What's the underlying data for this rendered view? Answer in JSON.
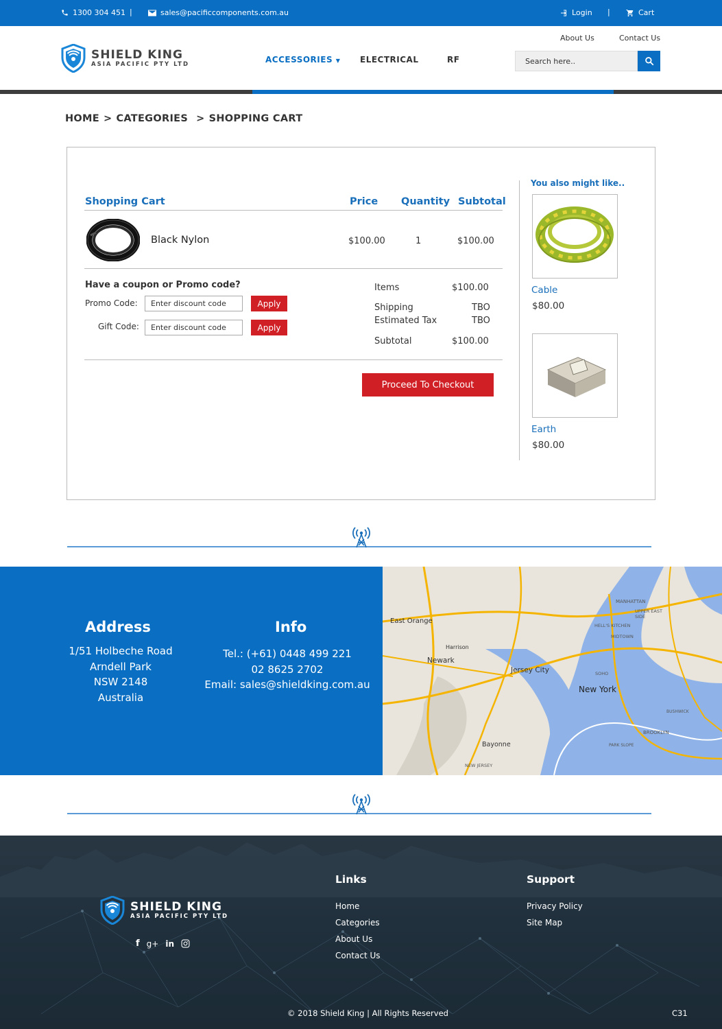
{
  "topbar": {
    "phone": "1300 304 451",
    "divider": "|",
    "email": "sales@pacificcomponents.com.au",
    "login": "Login",
    "cart": "Cart"
  },
  "header": {
    "about": "About Us",
    "contact": "Contact Us",
    "brand_line1": "SHIELD KING",
    "brand_line2": "ASIA PACIFIC PTY LTD",
    "nav": [
      "ACCESSORIES",
      "ELECTRICAL",
      "RF"
    ],
    "search_placeholder": "Search here.."
  },
  "breadcrumb": [
    "HOME",
    ">",
    "CATEGORIES",
    ">",
    "SHOPPING CART"
  ],
  "cart": {
    "title": "Shopping Cart",
    "col_price": "Price",
    "col_quantity": "Quantity",
    "col_subtotal": "Subtotal",
    "item": {
      "name": "Black Nylon",
      "price": "$100.00",
      "qty": "1",
      "subtotal": "$100.00"
    },
    "coupon_title": "Have a coupon or Promo code?",
    "promo_label": "Promo Code:",
    "gift_label": "Gift Code:",
    "code_placeholder": "Enter discount code",
    "apply": "Apply",
    "summary": {
      "items_label": "Items",
      "items_val": "$100.00",
      "shipping_label": "Shipping",
      "shipping_val": "TBO",
      "tax_label": "Estimated Tax",
      "tax_val": "TBO",
      "subtotal_label": "Subtotal",
      "subtotal_val": "$100.00"
    },
    "checkout": "Proceed To Checkout"
  },
  "recommend": {
    "title": "You also might like..",
    "items": [
      {
        "name": "Cable",
        "price": "$80.00"
      },
      {
        "name": "Earth",
        "price": "$80.00"
      }
    ]
  },
  "contact_section": {
    "address_title": "Address",
    "address_lines": [
      "1/51 Holbeche Road",
      "Arndell Park",
      "NSW 2148",
      "Australia"
    ],
    "info_title": "Info",
    "info_lines": [
      "Tel.: (+61) 0448 499 221",
      "02 8625 2702",
      "Email: sales@shieldking.com.au"
    ]
  },
  "map_labels": [
    "East Orange",
    "Harrison",
    "Newark",
    "Jersey City",
    "New York",
    "MANHATTAN",
    "MIDTOWN",
    "HELL'S KITCHEN",
    "UPPER EAST SIDE",
    "SOHO",
    "Bayonne",
    "BROOKLYN",
    "BUSHWICK",
    "PARK SLOPE",
    "NEW JERSEY"
  ],
  "footer": {
    "links_title": "Links",
    "links": [
      "Home",
      "Categories",
      "About Us",
      "Contact Us"
    ],
    "support_title": "Support",
    "support": [
      "Privacy Policy",
      "Site Map"
    ],
    "copyright": "© 2018 Shield King | All Rights Reserved",
    "code": "C31"
  },
  "colors": {
    "primary": "#0a6ec2",
    "accent_red": "#d01f25",
    "footer_bg": "#22313d"
  }
}
